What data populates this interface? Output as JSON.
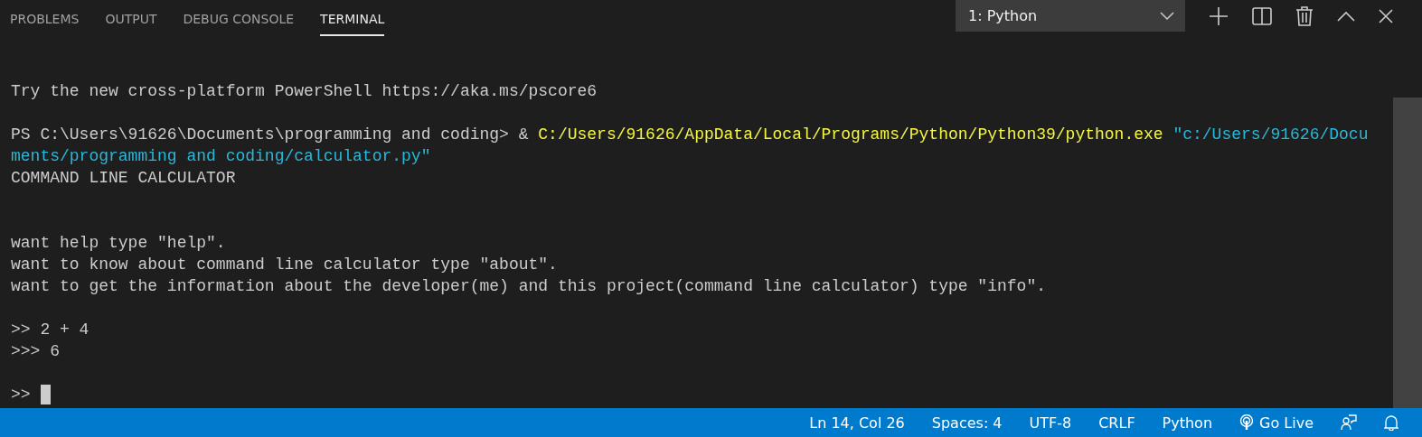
{
  "tabs": [
    {
      "label": "PROBLEMS",
      "selected": false
    },
    {
      "label": "OUTPUT",
      "selected": false
    },
    {
      "label": "DEBUG CONSOLE",
      "selected": false
    },
    {
      "label": "TERMINAL",
      "selected": true
    }
  ],
  "terminal_picker": {
    "value": "1: Python"
  },
  "terminal": {
    "lines": [
      {
        "kind": "blank"
      },
      {
        "kind": "blank"
      },
      {
        "kind": "output",
        "segments": [
          {
            "kind": "text",
            "text": "Try the new cross-platform PowerShell https://aka.ms/pscore6"
          }
        ]
      },
      {
        "kind": "blank"
      },
      {
        "kind": "output",
        "segments": [
          {
            "kind": "text",
            "text": "PS C:\\Users\\91626\\Documents\\programming and coding> & "
          },
          {
            "kind": "command",
            "text": "C:/Users/91626/AppData/Local/Programs/Python/Python39/python.exe"
          },
          {
            "kind": "string",
            "text": " \"c:/Users/91626/Docu"
          }
        ]
      },
      {
        "kind": "output",
        "segments": [
          {
            "kind": "string",
            "text": "ments/programming and coding/calculator.py\""
          }
        ]
      },
      {
        "kind": "output",
        "segments": [
          {
            "kind": "text",
            "text": "COMMAND LINE CALCULATOR"
          }
        ]
      },
      {
        "kind": "blank"
      },
      {
        "kind": "blank"
      },
      {
        "kind": "output",
        "segments": [
          {
            "kind": "text",
            "text": "want help type \"help\"."
          }
        ]
      },
      {
        "kind": "output",
        "segments": [
          {
            "kind": "text",
            "text": "want to know about command line calculator type \"about\"."
          }
        ]
      },
      {
        "kind": "output",
        "segments": [
          {
            "kind": "text",
            "text": "want to get the information about the developer(me) and this project(command line calculator) type \"info\"."
          }
        ]
      },
      {
        "kind": "blank"
      },
      {
        "kind": "output",
        "segments": [
          {
            "kind": "text",
            "text": ">> 2 + 4"
          }
        ]
      },
      {
        "kind": "output",
        "segments": [
          {
            "kind": "text",
            "text": ">>> 6"
          }
        ]
      },
      {
        "kind": "blank"
      },
      {
        "kind": "output",
        "segments": [
          {
            "kind": "text",
            "text": ">>"
          },
          {
            "kind": "cursor"
          }
        ]
      }
    ]
  },
  "status_bar": {
    "items": [
      {
        "kind": "text",
        "label": "Ln 14, Col 26"
      },
      {
        "kind": "text",
        "label": "Spaces: 4"
      },
      {
        "kind": "text",
        "label": "UTF-8"
      },
      {
        "kind": "text",
        "label": "CRLF"
      },
      {
        "kind": "text",
        "label": "Python"
      },
      {
        "kind": "live",
        "label": "Go Live"
      },
      {
        "kind": "feedback"
      },
      {
        "kind": "bell"
      }
    ]
  }
}
